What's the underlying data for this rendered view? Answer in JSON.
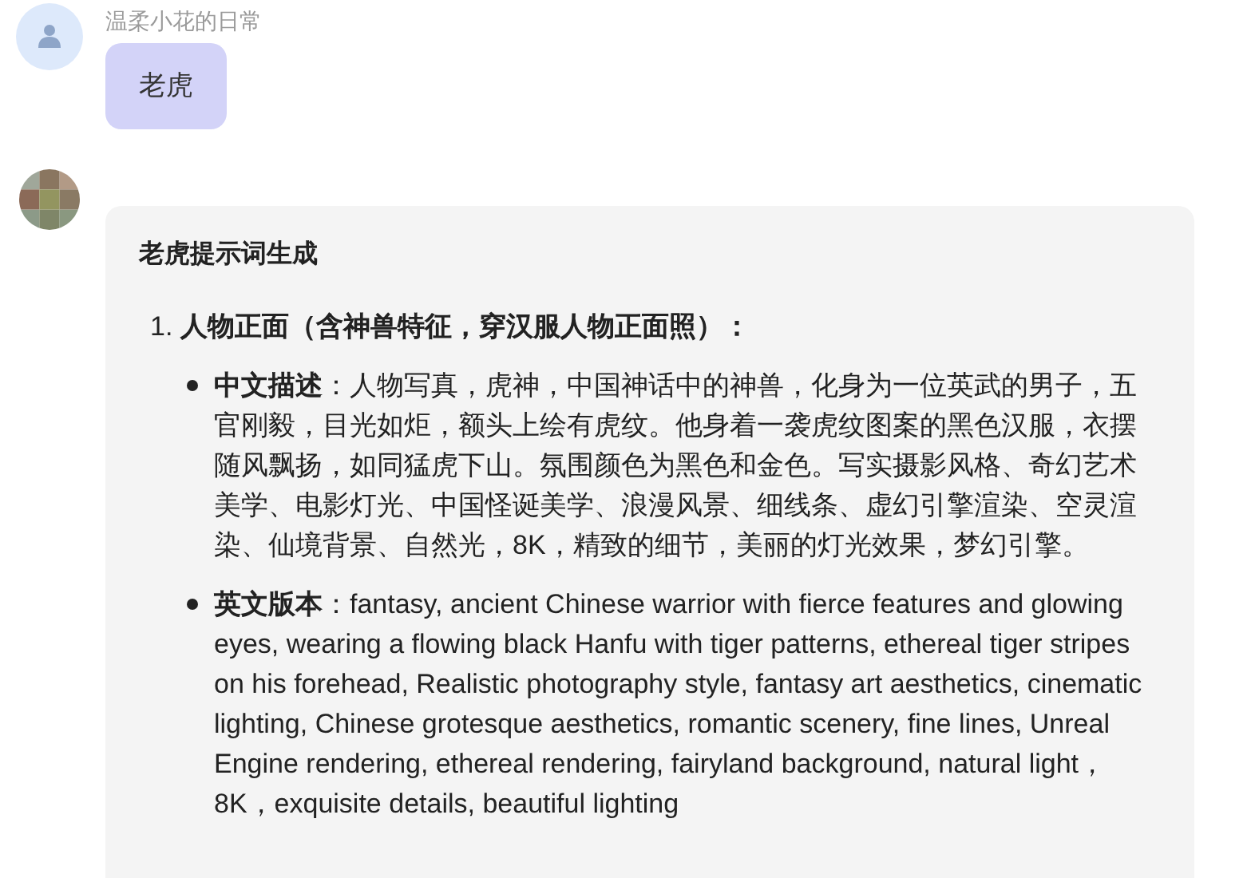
{
  "messages": [
    {
      "kind": "user",
      "sender": "温柔小花的日常",
      "text": "老虎"
    },
    {
      "kind": "bot",
      "title": "老虎提示词生成",
      "sections": [
        {
          "number": "1.",
          "heading": "人物正面（含神兽特征，穿汉服人物正面照）：",
          "bullets": [
            "**中文描述**：人物写真，虎神，中国神话中的神兽，化身为一位英武的男子，五官刚毅，目光如炬，额头上绘有虎纹。他身着一袭虎纹图案的黑色汉服，衣摆随风飘扬，如同猛虎下山。氛围颜色为黑色和金色。写实摄影风格、奇幻艺术美学、电影灯光、中国怪诞美学、浪漫风景、细线条、虚幻引擎渲染、空灵渲染、仙境背景、自然光，8K，精致的细节，美丽的灯光效果，梦幻引擎。",
            "**英文版本**：fantasy, ancient Chinese warrior with fierce features and glowing eyes, wearing a flowing black Hanfu with tiger patterns, ethereal tiger stripes on his forehead, Realistic photography style, fantasy art aesthetics, cinematic lighting, Chinese grotesque aesthetics, romantic scenery, fine lines, Unreal Engine rendering, ethereal rendering, fairyland background, natural light，8K，exquisite details, beautiful lighting"
          ]
        }
      ]
    }
  ]
}
